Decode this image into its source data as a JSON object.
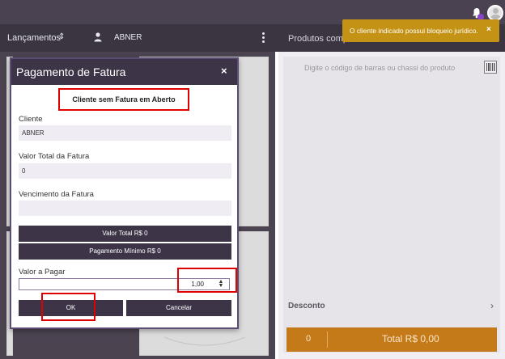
{
  "header": {
    "lancamentos_label": "Lançamentos",
    "user_name": "ABNER",
    "products_title": "Produtos comp"
  },
  "toast": {
    "message": "O cliente indicado possui bloqueio jurídico.",
    "close": "×"
  },
  "right_panel": {
    "barcode_placeholder": "Digite o código de barras ou chassi do produto",
    "desconto_label": "Desconto",
    "item_count": "0",
    "total_label": "Total R$ 0,00"
  },
  "modal": {
    "title": "Pagamento de Fatura",
    "close": "×",
    "status": "Cliente sem Fatura em Aberto",
    "cliente_label": "Cliente",
    "cliente_value": "ABNER",
    "valor_total_label": "Valor Total da Fatura",
    "valor_total_value": "0",
    "vencimento_label": "Vencimento da Fatura",
    "vencimento_value": "",
    "valor_total_button": "Valor Total R$ 0",
    "pagamento_minimo_button": "Pagamento Mínimo R$ 0",
    "valor_pagar_label": "Valor a Pagar",
    "valor_pagar_value": "1,00",
    "ok_button": "OK",
    "cancel_button": "Cancelar"
  },
  "colors": {
    "modal_header": "#3d3547",
    "toast": "#c49214",
    "total_bar": "#c57a1a",
    "highlight": "#e00000"
  }
}
